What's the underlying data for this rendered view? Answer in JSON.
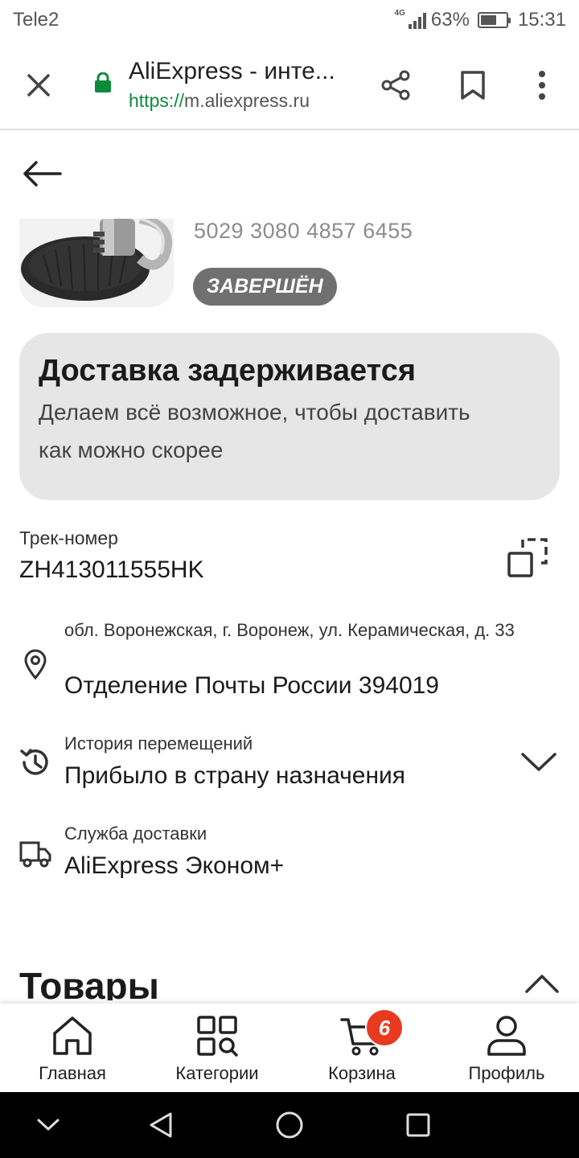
{
  "status_bar": {
    "carrier": "Tele2",
    "network": "4G",
    "battery_percent": "63%",
    "battery_level": 0.63,
    "time": "15:31"
  },
  "browser": {
    "title": "AliExpress - инте...",
    "url_scheme": "https://",
    "url_host": "m.aliexpress.ru",
    "icons": [
      "close-icon",
      "lock-icon",
      "share-icon",
      "bookmark-icon",
      "more-vert-icon"
    ]
  },
  "order": {
    "number": "5029 3080 4857 6455",
    "status": "ЗАВЕРШЁН"
  },
  "alert": {
    "title": "Доставка задерживается",
    "text": "Делаем всё возможное, чтобы доставить как можно скорее"
  },
  "tracking": {
    "label": "Трек-номер",
    "number": "ZH413011555HK"
  },
  "address": {
    "line1": "обл. Воронежская, г. Воронеж, ул. Керамическая, д. 33",
    "line2": "Отделение Почты России 394019"
  },
  "history": {
    "label": "История перемещений",
    "value": "Прибыло в страну назначения"
  },
  "service": {
    "label": "Служба доставки",
    "value": "AliExpress Эконом+"
  },
  "goods": {
    "title": "Товары"
  },
  "bottom_nav": {
    "items": [
      {
        "label": "Главная",
        "icon": "home-icon"
      },
      {
        "label": "Категории",
        "icon": "categories-icon"
      },
      {
        "label": "Корзина",
        "icon": "cart-icon",
        "badge": "6"
      },
      {
        "label": "Профиль",
        "icon": "profile-icon"
      }
    ]
  },
  "colors": {
    "secure_green": "#0c8a3c",
    "badge_gray": "#707070",
    "alert_bg": "#e6e6e6",
    "cart_badge": "#e83a1f"
  }
}
